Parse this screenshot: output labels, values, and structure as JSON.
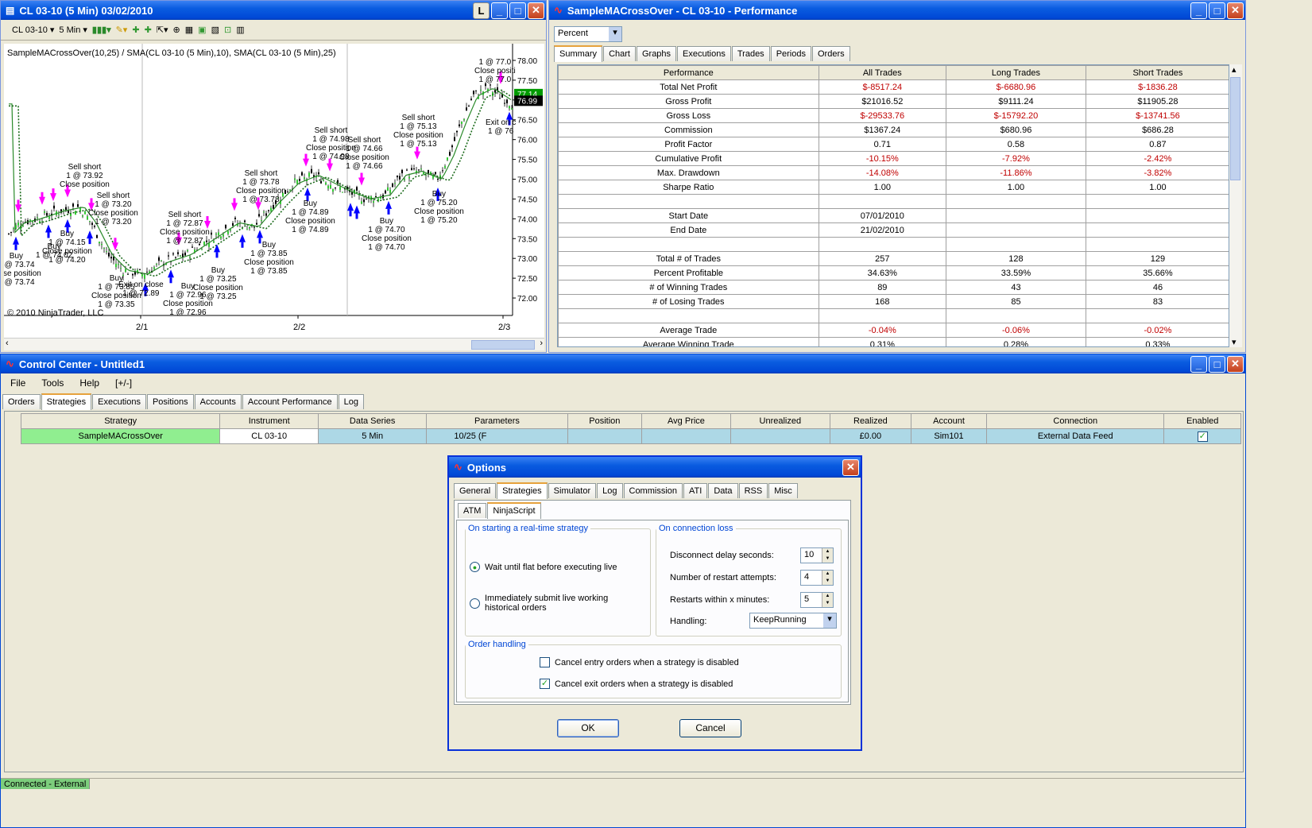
{
  "chart_window": {
    "title": "CL 03-10 (5 Min)  03/02/2010",
    "l_btn": "L",
    "instrument": "CL 03-10",
    "interval": "5 Min",
    "indicator_label": "SampleMACrossOver(10,25) / SMA(CL 03-10 (5 Min),10), SMA(CL 03-10 (5 Min),25)",
    "copyright": "© 2010 NinjaTrader, LLC",
    "price_last": "77.14",
    "price_close": "76.99",
    "y_ticks": [
      "78.00",
      "77.50",
      "77.00",
      "76.50",
      "76.00",
      "75.50",
      "75.00",
      "74.50",
      "74.00",
      "73.50",
      "73.00",
      "72.50",
      "72.00"
    ],
    "x_ticks": [
      "2/1",
      "2/2",
      "2/3"
    ]
  },
  "chart_annotations": [
    {
      "t": "Sell short\n1 @ 73.92\nClose position"
    },
    {
      "t": "Sell short\n1 @ 73.20\nClose position\n1 @ 73.20"
    },
    {
      "t": "Buy\n1 @ 74.15\nClose position\n1 @ 74.20"
    },
    {
      "t": "Buy\n1 @ 73.85\nClose position\n1 @ 73.35"
    },
    {
      "t": "Exit on close\n1 @ 72.89"
    },
    {
      "t": "Buy\n1 @ 72.96\nClose position\n1 @ 72.96"
    },
    {
      "t": "Sell short\n1 @ 72.87\nClose position\n1 @ 72.87"
    },
    {
      "t": "Buy\n1 @ 73.25\nClose position\n1 @ 73.25"
    },
    {
      "t": "Sell short\n1 @ 73.78\nClose position\n1 @ 73.78"
    },
    {
      "t": "Buy\n1 @ 73.85\nClose position\n1 @ 73.85"
    },
    {
      "t": "Sell short\n1 @ 74.98\nClose position\n1 @ 74.98"
    },
    {
      "t": "Buy\n1 @ 74.89\nClose position\n1 @ 74.89"
    },
    {
      "t": "Sell short\n1 @ 74.66\nClose position\n1 @ 74.66"
    },
    {
      "t": "Buy\n1 @ 74.70\nClose position\n1 @ 74.70"
    },
    {
      "t": "Sell short\n1 @ 75.13\nClose position\n1 @ 75.13"
    },
    {
      "t": "Buy\n1 @ 75.20\nClose position\n1 @ 75.20"
    },
    {
      "t": "1 @ 77.0\nClose positi\n1 @ 77.0"
    },
    {
      "t": "Exit on c\n1 @ 76"
    },
    {
      "t": "Buy\n1 @ 73.74\nClose position\n1 @ 73.74"
    },
    {
      "t": "Buy\n1 @ 74.02"
    }
  ],
  "perf_window": {
    "title": "SampleMACrossOver - CL 03-10 - Performance",
    "mode": "Percent",
    "tabs": [
      "Summary",
      "Chart",
      "Graphs",
      "Executions",
      "Trades",
      "Periods",
      "Orders"
    ],
    "active_tab": "Summary",
    "headers": [
      "Performance",
      "All Trades",
      "Long Trades",
      "Short Trades"
    ],
    "rows": [
      {
        "label": "Total Net Profit",
        "vals": [
          "$-8517.24",
          "$-6680.96",
          "$-1836.28"
        ],
        "red": true
      },
      {
        "label": "Gross Profit",
        "vals": [
          "$21016.52",
          "$9111.24",
          "$11905.28"
        ],
        "red": false
      },
      {
        "label": "Gross Loss",
        "vals": [
          "$-29533.76",
          "$-15792.20",
          "$-13741.56"
        ],
        "red": true
      },
      {
        "label": "Commission",
        "vals": [
          "$1367.24",
          "$680.96",
          "$686.28"
        ],
        "red": false
      },
      {
        "label": "Profit Factor",
        "vals": [
          "0.71",
          "0.58",
          "0.87"
        ],
        "red": false
      },
      {
        "label": "Cumulative Profit",
        "vals": [
          "-10.15%",
          "-7.92%",
          "-2.42%"
        ],
        "red": true
      },
      {
        "label": "Max. Drawdown",
        "vals": [
          "-14.08%",
          "-11.86%",
          "-3.82%"
        ],
        "red": true
      },
      {
        "label": "Sharpe Ratio",
        "vals": [
          "1.00",
          "1.00",
          "1.00"
        ],
        "red": false
      },
      {
        "label": "",
        "vals": [
          "",
          "",
          ""
        ],
        "red": false
      },
      {
        "label": "Start Date",
        "vals": [
          "07/01/2010",
          "",
          ""
        ],
        "red": false
      },
      {
        "label": "End Date",
        "vals": [
          "21/02/2010",
          "",
          ""
        ],
        "red": false
      },
      {
        "label": "",
        "vals": [
          "",
          "",
          ""
        ],
        "red": false
      },
      {
        "label": "Total # of Trades",
        "vals": [
          "257",
          "128",
          "129"
        ],
        "red": false
      },
      {
        "label": "Percent Profitable",
        "vals": [
          "34.63%",
          "33.59%",
          "35.66%"
        ],
        "red": false
      },
      {
        "label": "# of Winning Trades",
        "vals": [
          "89",
          "43",
          "46"
        ],
        "red": false
      },
      {
        "label": "# of Losing Trades",
        "vals": [
          "168",
          "85",
          "83"
        ],
        "red": false
      },
      {
        "label": "",
        "vals": [
          "",
          "",
          ""
        ],
        "red": false
      },
      {
        "label": "Average Trade",
        "vals": [
          "-0.04%",
          "-0.06%",
          "-0.02%"
        ],
        "red": true
      },
      {
        "label": "Average Winning Trade",
        "vals": [
          "0.31%",
          "0.28%",
          "0.33%"
        ],
        "red": false
      }
    ]
  },
  "control_center": {
    "title": "Control Center - Untitled1",
    "menu": [
      "File",
      "Tools",
      "Help",
      "[+/-]"
    ],
    "tabs": [
      "Orders",
      "Strategies",
      "Executions",
      "Positions",
      "Accounts",
      "Account Performance",
      "Log"
    ],
    "active_tab": "Strategies",
    "columns": [
      "Strategy",
      "Instrument",
      "Data Series",
      "Parameters",
      "Position",
      "Avg Price",
      "Unrealized",
      "Realized",
      "Account",
      "Connection",
      "Enabled"
    ],
    "row": {
      "strategy": "SampleMACrossOver",
      "instrument": "CL 03-10",
      "data_series": "5 Min",
      "parameters": "10/25 (F",
      "position": "",
      "avg_price": "",
      "unrealized": "",
      "realized": "£0.00",
      "account": "Sim101",
      "connection": "External Data Feed",
      "enabled": true
    },
    "status": "Connected - External"
  },
  "options": {
    "title": "Options",
    "tabs": [
      "General",
      "Strategies",
      "Simulator",
      "Log",
      "Commission",
      "ATI",
      "Data",
      "RSS",
      "Misc"
    ],
    "active_tab": "Strategies",
    "subtabs": [
      "ATM",
      "NinjaScript"
    ],
    "active_subtab": "NinjaScript",
    "group_start": "On starting a real-time strategy",
    "radio1": "Wait until flat before executing live",
    "radio2": "Immediately submit live working historical orders",
    "radio_selected": 1,
    "group_loss": "On connection loss",
    "disconnect_label": "Disconnect delay seconds:",
    "disconnect_val": "10",
    "restart_label": "Number of restart attempts:",
    "restart_val": "4",
    "restarts_min_label": "Restarts within x minutes:",
    "restarts_min_val": "5",
    "handling_label": "Handling:",
    "handling_val": "KeepRunning",
    "group_order": "Order handling",
    "cb1": "Cancel entry orders when a strategy is disabled",
    "cb1_checked": false,
    "cb2": "Cancel exit orders when a strategy is disabled",
    "cb2_checked": true,
    "ok": "OK",
    "cancel": "Cancel"
  },
  "colors": {
    "titlebar": "#0a5ce0",
    "strategy_cell": "#90ee90",
    "row_cell": "#add8e6",
    "loss": "#c00000",
    "buy_arrow": "#0000ff",
    "sell_arrow": "#ff00ff"
  }
}
